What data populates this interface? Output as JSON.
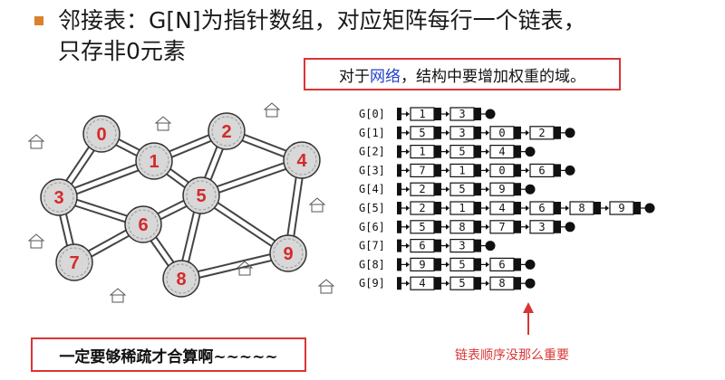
{
  "heading": {
    "line1": "邻接表：G[N]为指针数组，对应矩阵每行一个链表，",
    "line2": "只存非0元素"
  },
  "callout_top": {
    "pre": "对于",
    "highlight": "网络",
    "post": "，结构中要增加权重的域。"
  },
  "callout_bottom": "一定要够稀疏才合算啊~~~~~",
  "note": "链表顺序没那么重要",
  "colors": {
    "accent": "#d93535",
    "bullet": "#d9822b",
    "highlight": "#2040c8",
    "node_text": "#d42a2a"
  },
  "graph": {
    "nodes": [
      "0",
      "1",
      "2",
      "3",
      "4",
      "5",
      "6",
      "7",
      "8",
      "9"
    ]
  },
  "adjacency": [
    {
      "label": "G[0]",
      "items": [
        "1",
        "3"
      ]
    },
    {
      "label": "G[1]",
      "items": [
        "5",
        "3",
        "0",
        "2"
      ]
    },
    {
      "label": "G[2]",
      "items": [
        "1",
        "5",
        "4"
      ]
    },
    {
      "label": "G[3]",
      "items": [
        "7",
        "1",
        "0",
        "6"
      ]
    },
    {
      "label": "G[4]",
      "items": [
        "2",
        "5",
        "9"
      ]
    },
    {
      "label": "G[5]",
      "items": [
        "2",
        "1",
        "4",
        "6",
        "8",
        "9"
      ]
    },
    {
      "label": "G[6]",
      "items": [
        "5",
        "8",
        "7",
        "3"
      ]
    },
    {
      "label": "G[7]",
      "items": [
        "6",
        "3"
      ]
    },
    {
      "label": "G[8]",
      "items": [
        "9",
        "5",
        "6"
      ]
    },
    {
      "label": "G[9]",
      "items": [
        "4",
        "5",
        "8"
      ]
    }
  ]
}
